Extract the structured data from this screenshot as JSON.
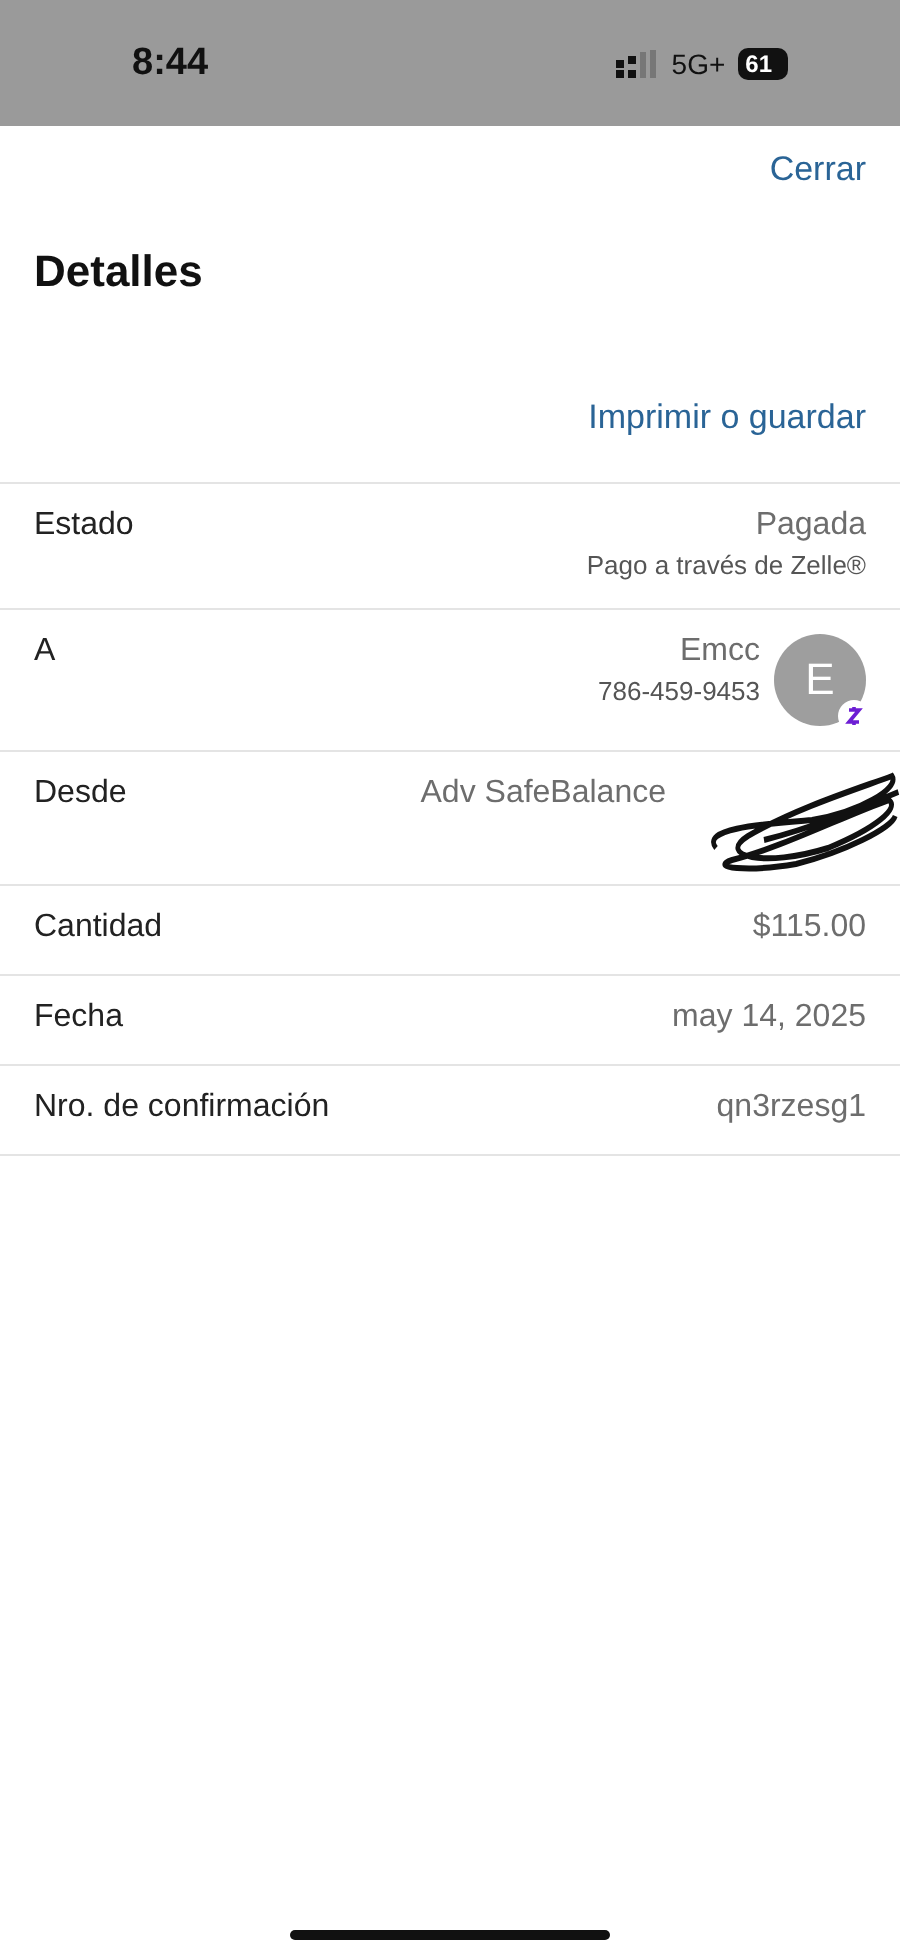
{
  "status_bar": {
    "time": "8:44",
    "network": "5G+",
    "battery": "61"
  },
  "header": {
    "close": "Cerrar",
    "title": "Detalles",
    "print": "Imprimir o guardar"
  },
  "rows": [
    {
      "kind": "status",
      "label": "Estado",
      "value": "Pagada",
      "sub": "Pago a través de Zelle®"
    },
    {
      "kind": "contact",
      "label": "A",
      "value": "Emcc",
      "sub": "786-459-9453",
      "avatar": "E"
    },
    {
      "kind": "simple",
      "label": "Desde",
      "value": "Adv SafeBalance",
      "redacted": true
    },
    {
      "kind": "simple",
      "label": "Cantidad",
      "value": "$115.00",
      "redacted": false
    },
    {
      "kind": "simple",
      "label": "Fecha",
      "value": "may 14, 2025",
      "redacted": false
    },
    {
      "kind": "simple",
      "label": "Nro. de confirmación",
      "value": "qn3rzesg1",
      "redacted": false
    }
  ]
}
